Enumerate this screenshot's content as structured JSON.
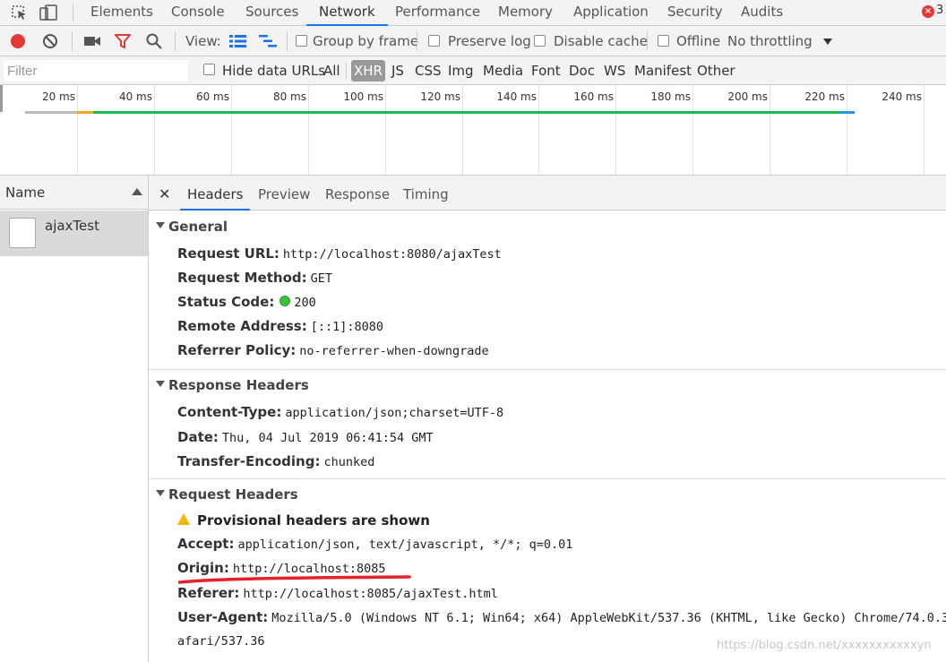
{
  "topbar": {
    "tabs": [
      "Elements",
      "Console",
      "Sources",
      "Network",
      "Performance",
      "Memory",
      "Application",
      "Security",
      "Audits"
    ],
    "active_tab": "Network",
    "error_count": "3"
  },
  "toolbar": {
    "view_label": "View:",
    "group_by_frame": "Group by frame",
    "preserve_log": "Preserve log",
    "disable_cache": "Disable cache",
    "offline": "Offline",
    "throttling": "No throttling"
  },
  "filterbar": {
    "filter_placeholder": "Filter",
    "hide_data_urls": "Hide data URLs",
    "types": [
      "All",
      "XHR",
      "JS",
      "CSS",
      "Img",
      "Media",
      "Font",
      "Doc",
      "WS",
      "Manifest",
      "Other"
    ],
    "selected_type": "XHR"
  },
  "timeline": {
    "ticks": [
      "20 ms",
      "40 ms",
      "60 ms",
      "80 ms",
      "100 ms",
      "120 ms",
      "140 ms",
      "160 ms",
      "180 ms",
      "200 ms",
      "220 ms",
      "240 ms"
    ]
  },
  "requests": {
    "column_name": "Name",
    "items": [
      {
        "name": "ajaxTest"
      }
    ]
  },
  "detail": {
    "tabs": [
      "Headers",
      "Preview",
      "Response",
      "Timing"
    ],
    "active_tab": "Headers",
    "general": {
      "title": "General",
      "request_url_label": "Request URL:",
      "request_url": "http://localhost:8080/ajaxTest",
      "request_method_label": "Request Method:",
      "request_method": "GET",
      "status_code_label": "Status Code:",
      "status_code": "200",
      "remote_address_label": "Remote Address:",
      "remote_address": "[::1]:8080",
      "referrer_policy_label": "Referrer Policy:",
      "referrer_policy": "no-referrer-when-downgrade"
    },
    "response_headers": {
      "title": "Response Headers",
      "content_type_label": "Content-Type:",
      "content_type": "application/json;charset=UTF-8",
      "date_label": "Date:",
      "date": "Thu, 04 Jul 2019 06:41:54 GMT",
      "transfer_encoding_label": "Transfer-Encoding:",
      "transfer_encoding": "chunked"
    },
    "request_headers": {
      "title": "Request Headers",
      "provisional_warning": "Provisional headers are shown",
      "accept_label": "Accept:",
      "accept": "application/json, text/javascript, */*; q=0.01",
      "origin_label": "Origin:",
      "origin": "http://localhost:8085",
      "referer_label": "Referer:",
      "referer": "http://localhost:8085/ajaxTest.html",
      "user_agent_label": "User-Agent:",
      "user_agent": "Mozilla/5.0 (Windows NT 6.1; Win64; x64) AppleWebKit/537.36 (KHTML, like Gecko) Chrome/74.0.3",
      "user_agent_cont": "afari/537.36"
    }
  },
  "watermark": "https://blog.csdn.net/xxxxxxxxxxxyn",
  "colors": {
    "accent": "#1a73e8",
    "record": "#e53935",
    "status_ok": "#3dc23d",
    "annotation": "#e8202a"
  }
}
